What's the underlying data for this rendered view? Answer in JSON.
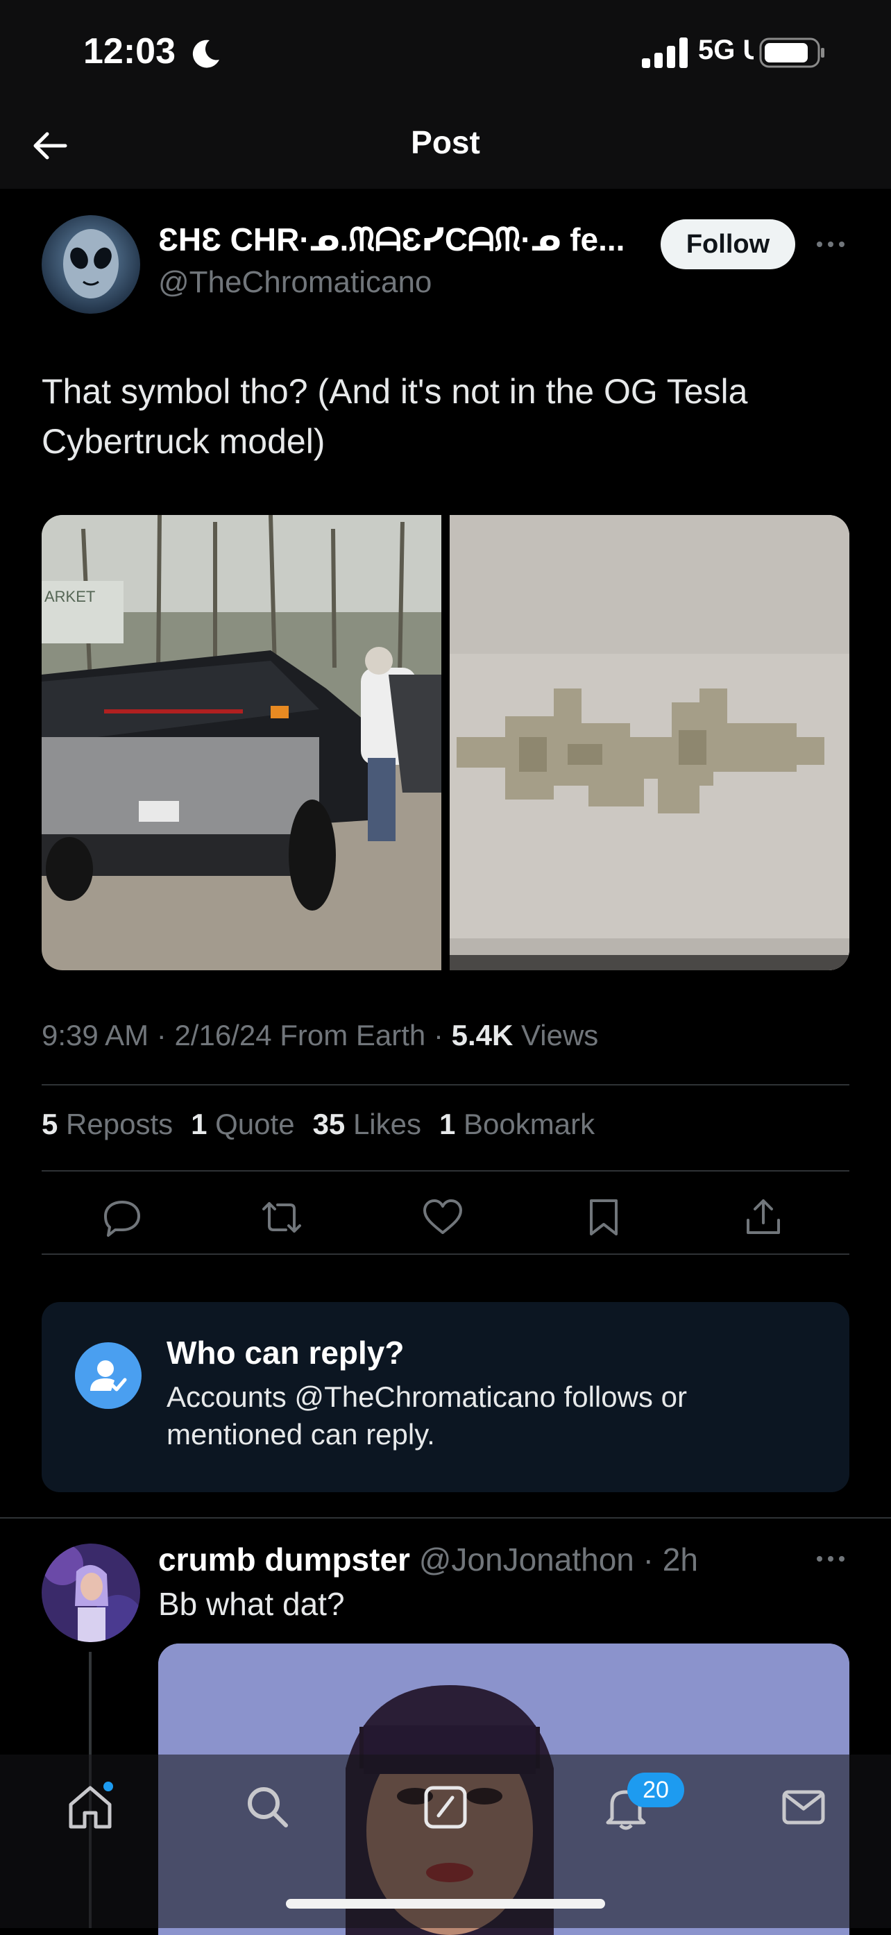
{
  "status_bar": {
    "time": "12:03",
    "network": "5G UC"
  },
  "header": {
    "title": "Post"
  },
  "post": {
    "author_name": "ƐHƐ CHR·ᓄ.ᙏᗩƐᓯCᗩᙏ·ᓄ fe...",
    "author_handle": "@TheChromaticano",
    "follow_label": "Follow",
    "text": "That symbol tho? (And it's not in the OG Tesla Cybertruck model)",
    "meta": {
      "time": "9:39 AM",
      "date": "2/16/24",
      "source": "From Earth",
      "views_count": "5.4K",
      "views_label": "Views"
    },
    "stats": {
      "reposts_count": "5",
      "reposts_label": "Reposts",
      "quotes_count": "1",
      "quotes_label": "Quote",
      "likes_count": "35",
      "likes_label": "Likes",
      "bookmarks_count": "1",
      "bookmarks_label": "Bookmark"
    },
    "media_left_sign": "ARKET"
  },
  "actions": [
    "reply-icon",
    "repost-icon",
    "like-icon",
    "bookmark-icon",
    "share-icon"
  ],
  "who_can_reply": {
    "title": "Who can reply?",
    "description": "Accounts @TheChromaticano follows or mentioned can reply."
  },
  "reply": {
    "name": "crumb dumpster",
    "handle": "@JonJonathon",
    "time": "2h",
    "text": "Bb what dat?"
  },
  "tabbar": {
    "items": [
      "home-icon",
      "search-icon",
      "compose-icon",
      "notifications-icon",
      "messages-icon"
    ],
    "notifications_badge": "20"
  },
  "colors": {
    "accent": "#1d9bf0",
    "background": "#000000",
    "secondary_text": "#71767b"
  }
}
